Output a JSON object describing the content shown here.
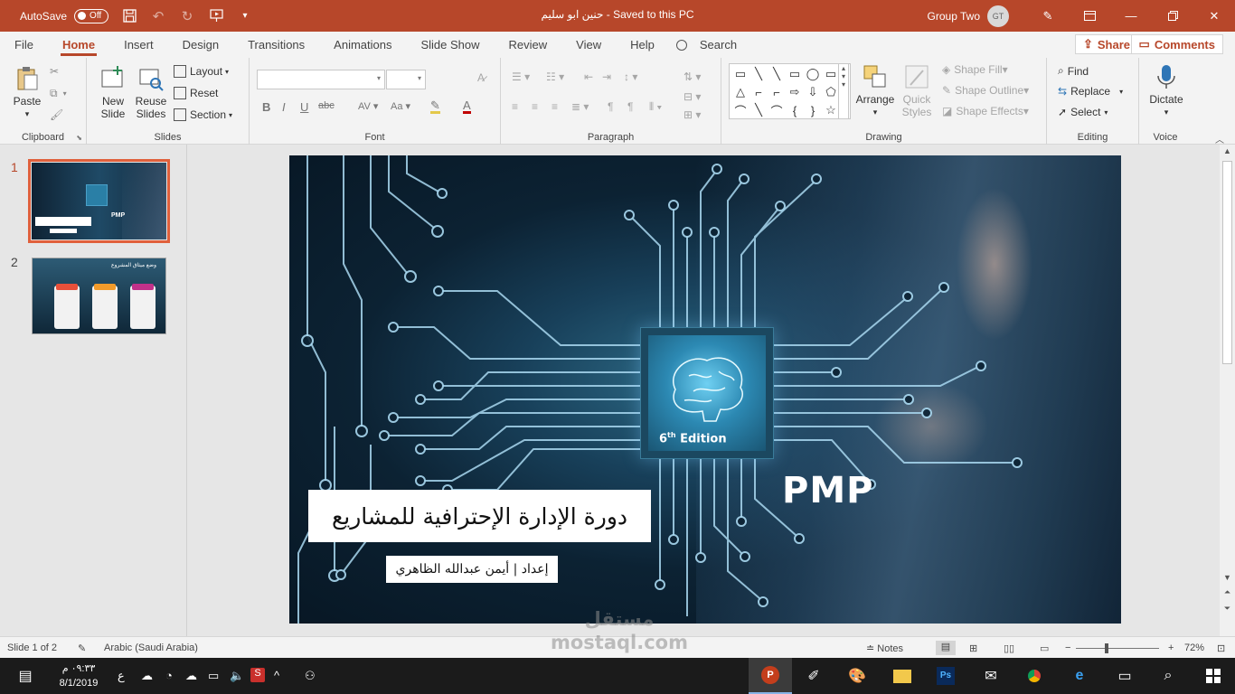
{
  "titlebar": {
    "autosave_label": "AutoSave",
    "autosave_state": "Off",
    "doc_title": "حنين ابو سليم  -  Saved to this PC",
    "user_name": "Group Two",
    "user_initials": "GT",
    "accent": "#b7472a"
  },
  "tabs": [
    "File",
    "Home",
    "Insert",
    "Design",
    "Transitions",
    "Animations",
    "Slide Show",
    "Review",
    "View",
    "Help"
  ],
  "active_tab": "Home",
  "search_label": "Search",
  "share_label": "Share",
  "comments_label": "Comments",
  "ribbon": {
    "clipboard": {
      "label": "Clipboard",
      "paste": "Paste"
    },
    "slides": {
      "label": "Slides",
      "new_slide": "New Slide",
      "reuse_slides": "Reuse Slides",
      "layout": "Layout",
      "reset": "Reset",
      "section": "Section"
    },
    "font": {
      "label": "Font",
      "bold": "B",
      "italic": "I",
      "underline": "U",
      "strike": "abc"
    },
    "paragraph": {
      "label": "Paragraph"
    },
    "drawing": {
      "label": "Drawing",
      "arrange": "Arrange",
      "quick_styles": "Quick Styles",
      "shape_fill": "Shape Fill",
      "shape_outline": "Shape Outline",
      "shape_effects": "Shape Effects"
    },
    "editing": {
      "label": "Editing",
      "find": "Find",
      "replace": "Replace",
      "select": "Select"
    },
    "voice": {
      "label": "Voice",
      "dictate": "Dictate"
    }
  },
  "thumbnails": {
    "items": [
      {
        "number": "1",
        "title": "PMP"
      },
      {
        "number": "2",
        "title": "وضع ميثاق المشروع"
      }
    ]
  },
  "slide": {
    "edition": "6",
    "edition_sup": "th",
    "edition_word": "Edition",
    "pmp": "PMP",
    "title": "دورة الإدارة الإحترافية للمشاريع",
    "author": "إعداد | أيمن عبدالله الظاهري"
  },
  "status": {
    "slide_info": "Slide 1 of 2",
    "language": "Arabic (Saudi Arabia)",
    "notes": "Notes",
    "zoom": "72%"
  },
  "taskbar": {
    "time": "٠٩:٣٣ م",
    "date": "8/1/2019",
    "lang": "ع"
  },
  "watermark": {
    "arabic": "مستقل",
    "latin": "mostaql.com"
  }
}
